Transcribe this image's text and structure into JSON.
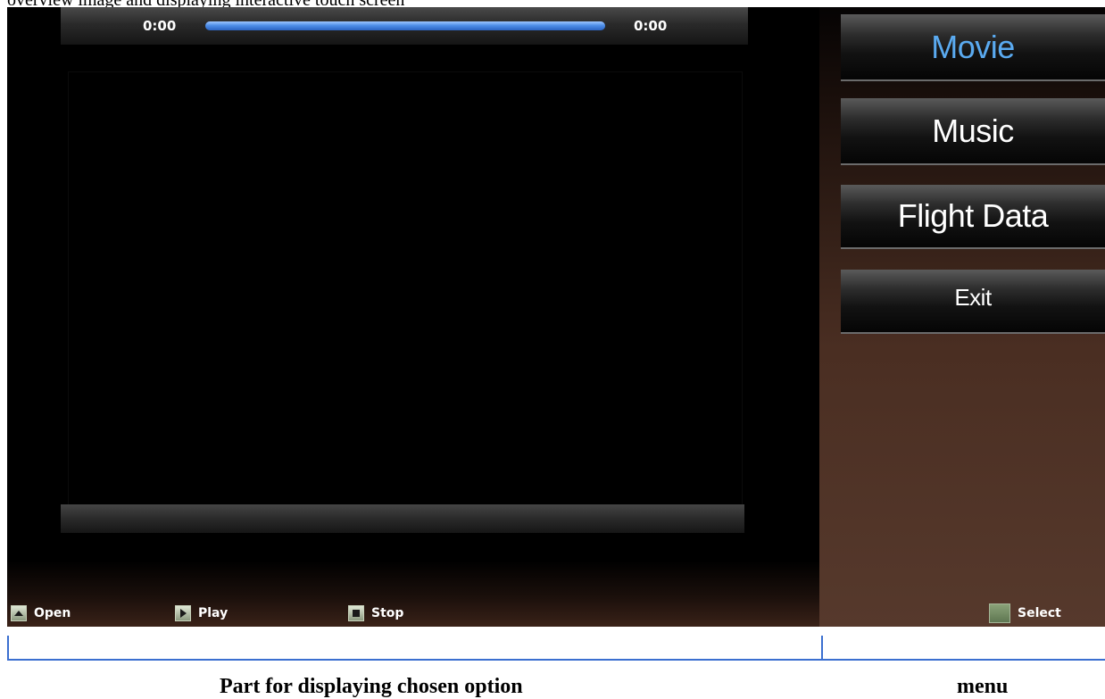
{
  "top_caption": "overview image and displaying interactive touch screen",
  "player": {
    "time_start": "0:00",
    "time_end": "0:00",
    "progress": 1.0,
    "controls": {
      "open": "Open",
      "play": "Play",
      "stop": "Stop"
    }
  },
  "menu": {
    "items": [
      "Movie",
      "Music",
      "Flight Data",
      "Exit"
    ],
    "active": "Movie",
    "select_label": "Select"
  },
  "annotations": {
    "left_caption": "Part for displaying chosen option",
    "right_caption": "menu"
  },
  "colors": {
    "accent": "#5aaaf0",
    "progress": "#4f8fe8"
  }
}
